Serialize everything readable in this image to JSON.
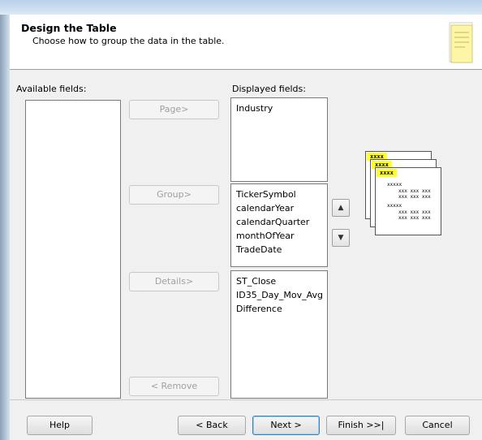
{
  "header": {
    "title": "Design the Table",
    "subtitle": "Choose how to group the data in the table."
  },
  "labels": {
    "available": "Available fields:",
    "displayed": "Displayed fields:"
  },
  "available_fields": [],
  "page_fields": [
    "Industry"
  ],
  "group_fields": [
    "TickerSymbol",
    "calendarYear",
    "calendarQuarter",
    "monthOfYear",
    "TradeDate"
  ],
  "detail_fields": [
    "ST_Close",
    "ID35_Day_Mov_Avg",
    "Difference"
  ],
  "buttons": {
    "page": "Page>",
    "group": "Group>",
    "details": "Details>",
    "remove": "< Remove",
    "help": "Help",
    "back": "< Back",
    "next": "Next >",
    "finish": "Finish >>|",
    "cancel": "Cancel"
  },
  "icons": {
    "move_up": "arrow-up",
    "move_down": "arrow-down",
    "wizard": "wizard-notes-icon",
    "preview": "table-preview"
  },
  "preview": {
    "tag": "xxxx",
    "line1": "xxxxx",
    "line2": "xxx xxx xxx",
    "line3": "xxx xxx xxx",
    "line4": "xxxxx",
    "line5": "xxx xxx xxx",
    "line6": "xxx xxx xxx"
  },
  "colors": {
    "highlight": "#ffff30",
    "primary_border": "#3c7fb1"
  }
}
